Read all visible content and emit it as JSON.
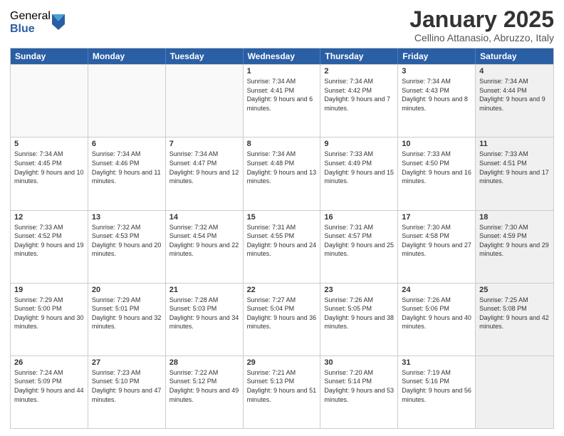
{
  "logo": {
    "general": "General",
    "blue": "Blue"
  },
  "header": {
    "title": "January 2025",
    "subtitle": "Cellino Attanasio, Abruzzo, Italy"
  },
  "weekdays": [
    "Sunday",
    "Monday",
    "Tuesday",
    "Wednesday",
    "Thursday",
    "Friday",
    "Saturday"
  ],
  "weeks": [
    [
      {
        "day": "",
        "info": "",
        "empty": true
      },
      {
        "day": "",
        "info": "",
        "empty": true
      },
      {
        "day": "",
        "info": "",
        "empty": true
      },
      {
        "day": "1",
        "info": "Sunrise: 7:34 AM\nSunset: 4:41 PM\nDaylight: 9 hours and 6 minutes."
      },
      {
        "day": "2",
        "info": "Sunrise: 7:34 AM\nSunset: 4:42 PM\nDaylight: 9 hours and 7 minutes."
      },
      {
        "day": "3",
        "info": "Sunrise: 7:34 AM\nSunset: 4:43 PM\nDaylight: 9 hours and 8 minutes."
      },
      {
        "day": "4",
        "info": "Sunrise: 7:34 AM\nSunset: 4:44 PM\nDaylight: 9 hours and 9 minutes.",
        "shaded": true
      }
    ],
    [
      {
        "day": "5",
        "info": "Sunrise: 7:34 AM\nSunset: 4:45 PM\nDaylight: 9 hours and 10 minutes."
      },
      {
        "day": "6",
        "info": "Sunrise: 7:34 AM\nSunset: 4:46 PM\nDaylight: 9 hours and 11 minutes."
      },
      {
        "day": "7",
        "info": "Sunrise: 7:34 AM\nSunset: 4:47 PM\nDaylight: 9 hours and 12 minutes."
      },
      {
        "day": "8",
        "info": "Sunrise: 7:34 AM\nSunset: 4:48 PM\nDaylight: 9 hours and 13 minutes."
      },
      {
        "day": "9",
        "info": "Sunrise: 7:33 AM\nSunset: 4:49 PM\nDaylight: 9 hours and 15 minutes."
      },
      {
        "day": "10",
        "info": "Sunrise: 7:33 AM\nSunset: 4:50 PM\nDaylight: 9 hours and 16 minutes."
      },
      {
        "day": "11",
        "info": "Sunrise: 7:33 AM\nSunset: 4:51 PM\nDaylight: 9 hours and 17 minutes.",
        "shaded": true
      }
    ],
    [
      {
        "day": "12",
        "info": "Sunrise: 7:33 AM\nSunset: 4:52 PM\nDaylight: 9 hours and 19 minutes."
      },
      {
        "day": "13",
        "info": "Sunrise: 7:32 AM\nSunset: 4:53 PM\nDaylight: 9 hours and 20 minutes."
      },
      {
        "day": "14",
        "info": "Sunrise: 7:32 AM\nSunset: 4:54 PM\nDaylight: 9 hours and 22 minutes."
      },
      {
        "day": "15",
        "info": "Sunrise: 7:31 AM\nSunset: 4:55 PM\nDaylight: 9 hours and 24 minutes."
      },
      {
        "day": "16",
        "info": "Sunrise: 7:31 AM\nSunset: 4:57 PM\nDaylight: 9 hours and 25 minutes."
      },
      {
        "day": "17",
        "info": "Sunrise: 7:30 AM\nSunset: 4:58 PM\nDaylight: 9 hours and 27 minutes."
      },
      {
        "day": "18",
        "info": "Sunrise: 7:30 AM\nSunset: 4:59 PM\nDaylight: 9 hours and 29 minutes.",
        "shaded": true
      }
    ],
    [
      {
        "day": "19",
        "info": "Sunrise: 7:29 AM\nSunset: 5:00 PM\nDaylight: 9 hours and 30 minutes."
      },
      {
        "day": "20",
        "info": "Sunrise: 7:29 AM\nSunset: 5:01 PM\nDaylight: 9 hours and 32 minutes."
      },
      {
        "day": "21",
        "info": "Sunrise: 7:28 AM\nSunset: 5:03 PM\nDaylight: 9 hours and 34 minutes."
      },
      {
        "day": "22",
        "info": "Sunrise: 7:27 AM\nSunset: 5:04 PM\nDaylight: 9 hours and 36 minutes."
      },
      {
        "day": "23",
        "info": "Sunrise: 7:26 AM\nSunset: 5:05 PM\nDaylight: 9 hours and 38 minutes."
      },
      {
        "day": "24",
        "info": "Sunrise: 7:26 AM\nSunset: 5:06 PM\nDaylight: 9 hours and 40 minutes."
      },
      {
        "day": "25",
        "info": "Sunrise: 7:25 AM\nSunset: 5:08 PM\nDaylight: 9 hours and 42 minutes.",
        "shaded": true
      }
    ],
    [
      {
        "day": "26",
        "info": "Sunrise: 7:24 AM\nSunset: 5:09 PM\nDaylight: 9 hours and 44 minutes."
      },
      {
        "day": "27",
        "info": "Sunrise: 7:23 AM\nSunset: 5:10 PM\nDaylight: 9 hours and 47 minutes."
      },
      {
        "day": "28",
        "info": "Sunrise: 7:22 AM\nSunset: 5:12 PM\nDaylight: 9 hours and 49 minutes."
      },
      {
        "day": "29",
        "info": "Sunrise: 7:21 AM\nSunset: 5:13 PM\nDaylight: 9 hours and 51 minutes."
      },
      {
        "day": "30",
        "info": "Sunrise: 7:20 AM\nSunset: 5:14 PM\nDaylight: 9 hours and 53 minutes."
      },
      {
        "day": "31",
        "info": "Sunrise: 7:19 AM\nSunset: 5:16 PM\nDaylight: 9 hours and 56 minutes."
      },
      {
        "day": "",
        "info": "",
        "empty": true,
        "shaded": true
      }
    ]
  ]
}
